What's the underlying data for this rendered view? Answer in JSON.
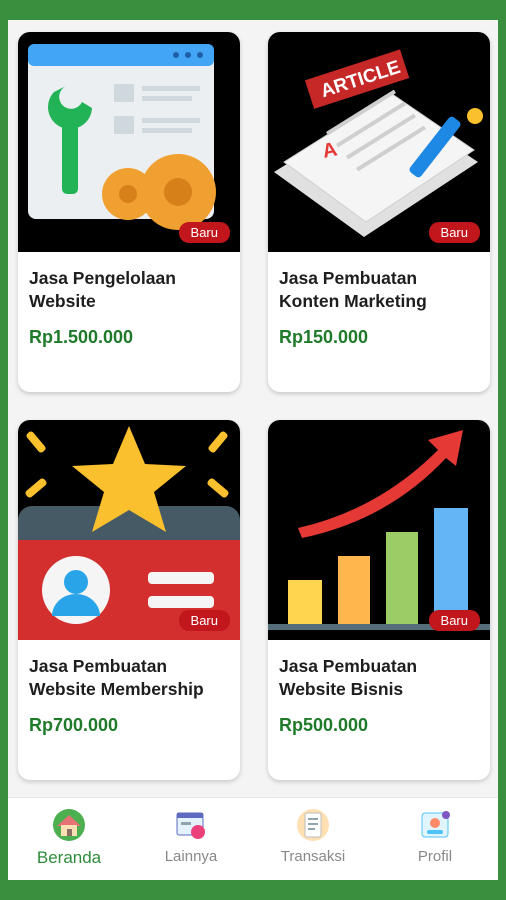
{
  "products": [
    {
      "title": "Jasa Pengelolaan Website",
      "price": "Rp1.500.000",
      "badge": "Baru",
      "image_icon": "website-maintenance-icon"
    },
    {
      "title": "Jasa Pembuatan Konten Marketing",
      "price": "Rp150.000",
      "badge": "Baru",
      "image_icon": "article-newspaper-icon",
      "image_text": "ARTICLE"
    },
    {
      "title": "Jasa Pembuatan Website Membership",
      "price": "Rp700.000",
      "badge": "Baru",
      "image_icon": "membership-card-star-icon"
    },
    {
      "title": "Jasa Pembuatan Website Bisnis",
      "price": "Rp500.000",
      "badge": "Baru",
      "image_icon": "growth-bar-chart-icon"
    }
  ],
  "nav": [
    {
      "label": "Beranda",
      "icon": "home-icon",
      "active": true
    },
    {
      "label": "Lainnya",
      "icon": "browser-icon",
      "active": false
    },
    {
      "label": "Transaksi",
      "icon": "bill-icon",
      "active": false
    },
    {
      "label": "Profil",
      "icon": "profile-icon",
      "active": false
    }
  ],
  "colors": {
    "frame": "#3a8f3f",
    "price": "#1f7a2a",
    "badge": "#c0161c",
    "active_nav": "#2e8b3a"
  }
}
